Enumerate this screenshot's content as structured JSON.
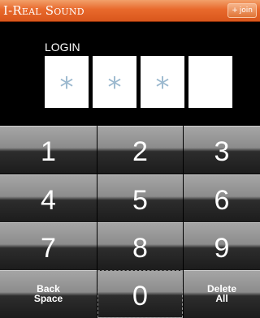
{
  "header": {
    "app_title": "I-Real Sound",
    "join_label": "join",
    "join_icon": "+"
  },
  "login": {
    "label": "LOGIN",
    "boxes": [
      "*",
      "*",
      "*",
      ""
    ]
  },
  "keypad": {
    "digits": [
      "1",
      "2",
      "3",
      "4",
      "5",
      "6",
      "7",
      "8",
      "9",
      "0"
    ],
    "back_space_line1": "Back",
    "back_space_line2": "Space",
    "delete_all_line1": "Delete",
    "delete_all_line2": "All"
  }
}
